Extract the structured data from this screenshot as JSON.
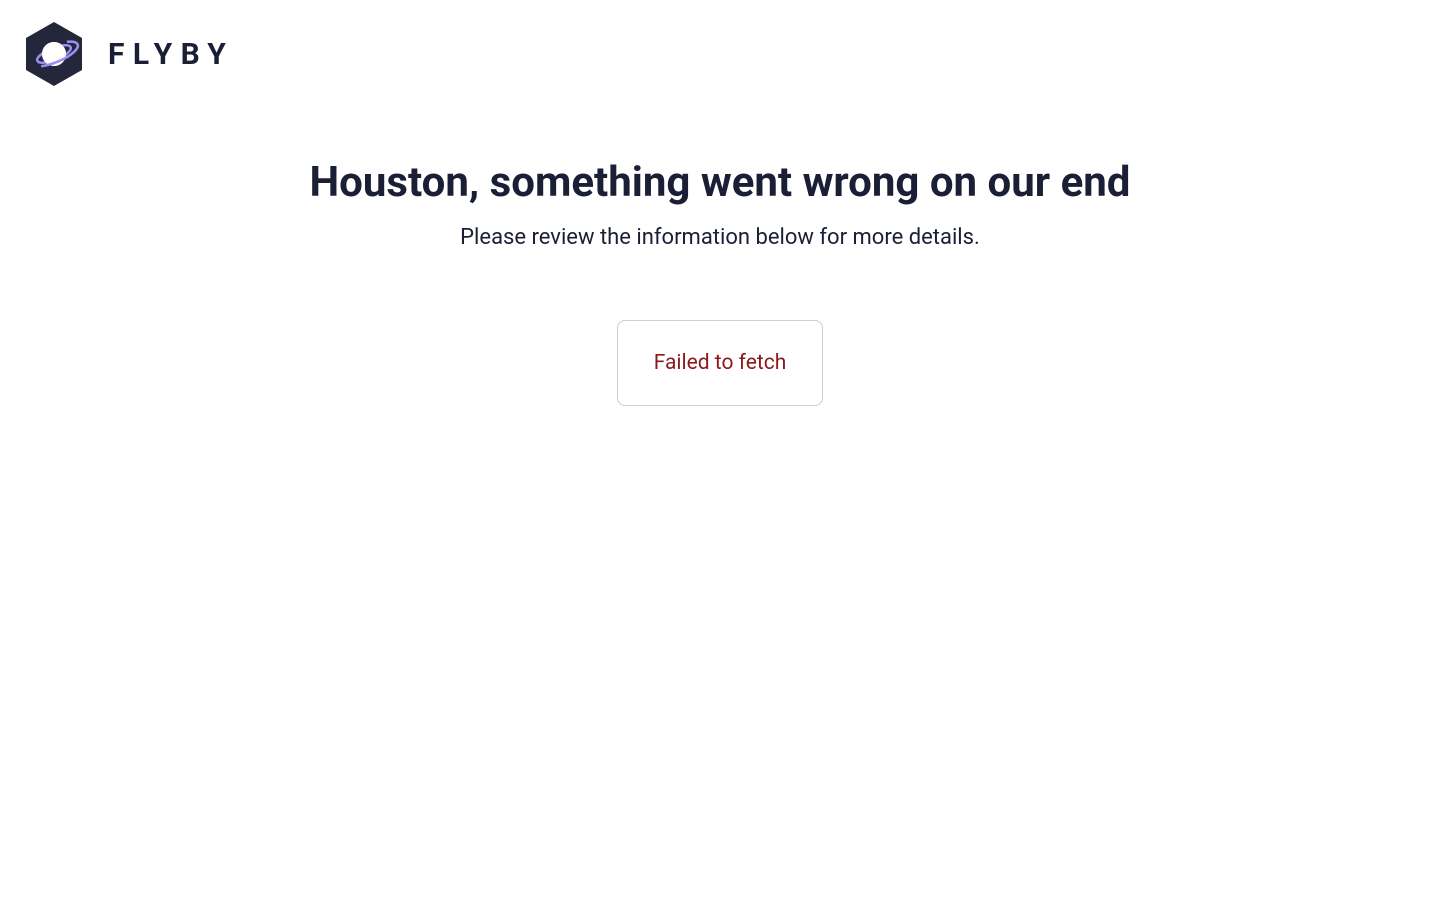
{
  "brand": {
    "name": "FLYBY"
  },
  "error": {
    "title": "Houston, something went wrong on our end",
    "subtitle": "Please review the information below for more details.",
    "message": "Failed to fetch"
  }
}
